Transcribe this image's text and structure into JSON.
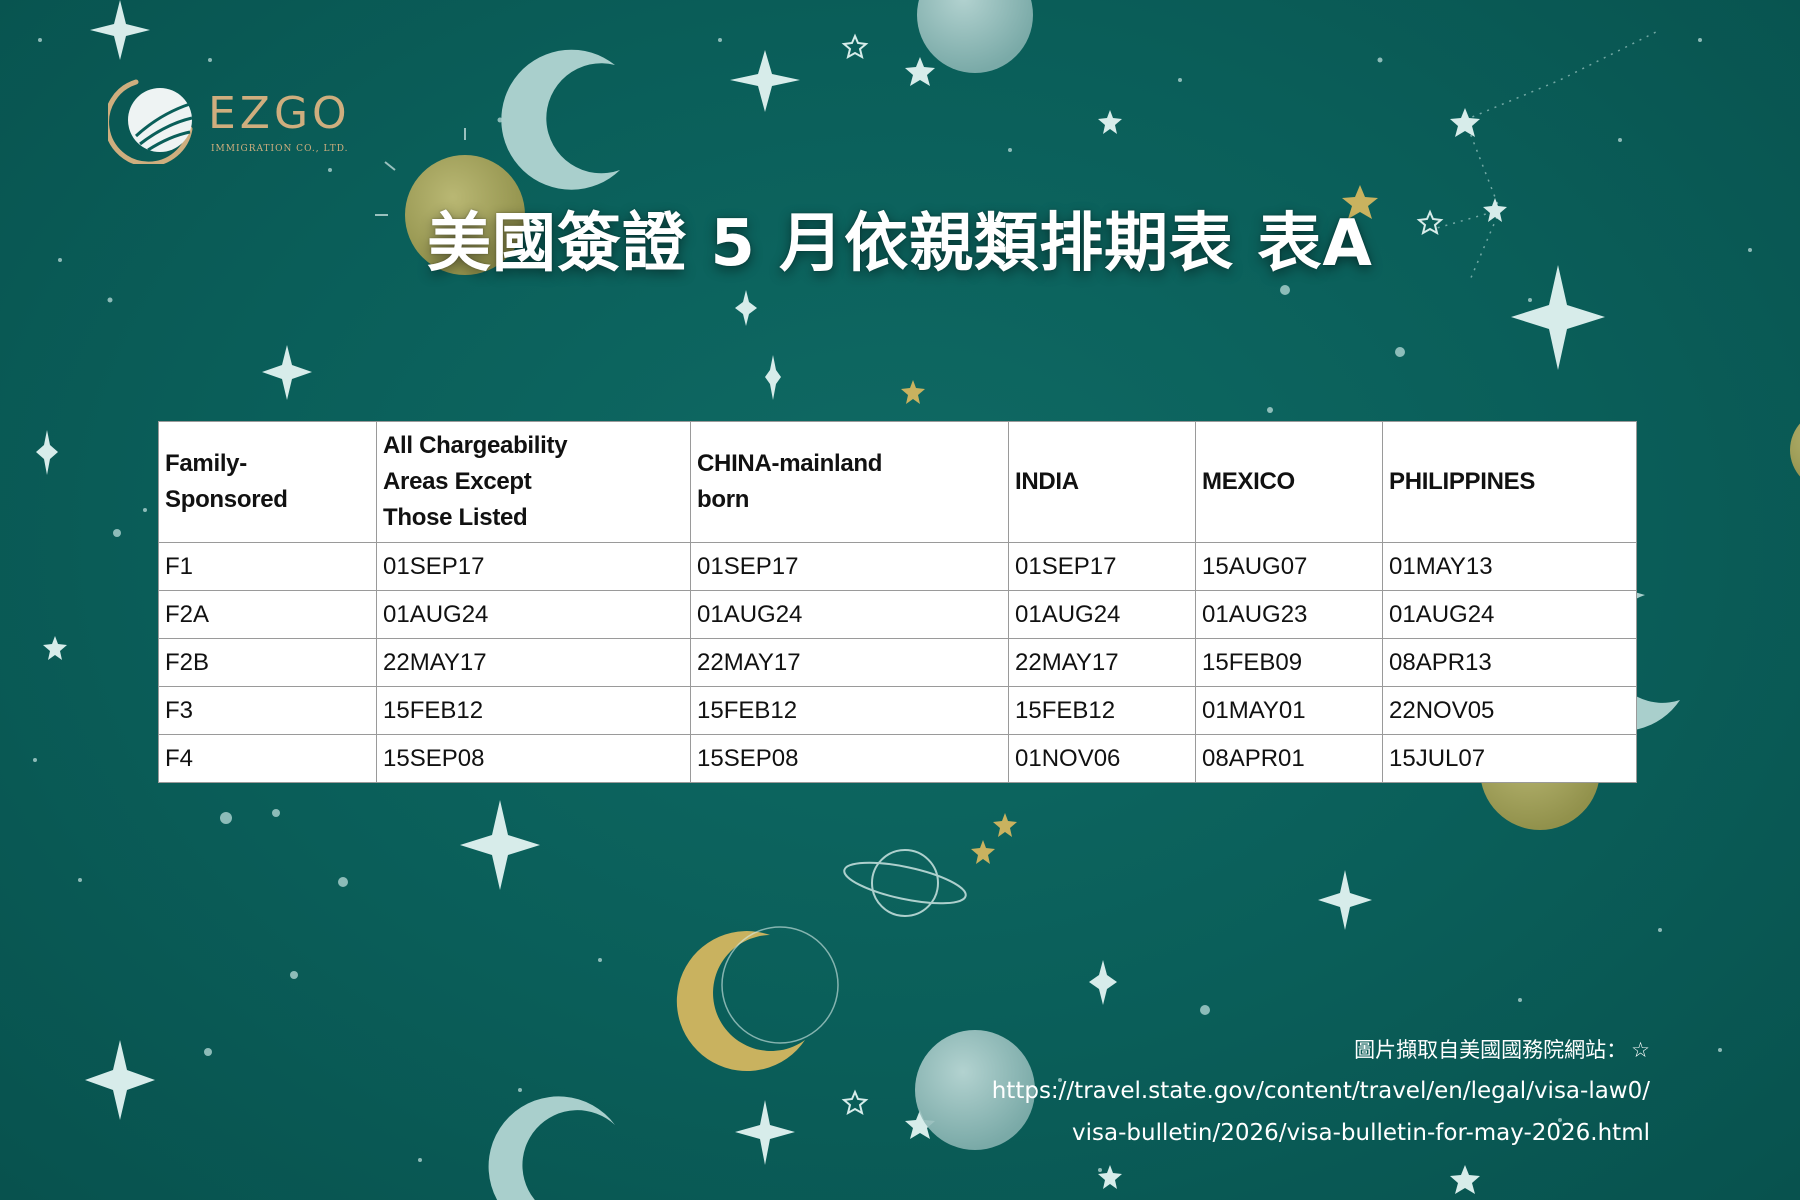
{
  "logo": {
    "name": "EZGO",
    "subtitle": "IMMIGRATION CO., LTD."
  },
  "title": "美國簽證 5 月依親類排期表 表A",
  "table": {
    "headers": [
      "Family-\nSponsored",
      "All Chargeability\nAreas Except\nThose Listed",
      "CHINA-mainland\nborn",
      "INDIA",
      "MEXICO",
      "PHILIPPINES"
    ],
    "rows": [
      [
        "F1",
        "01SEP17",
        "01SEP17",
        "01SEP17",
        "15AUG07",
        "01MAY13"
      ],
      [
        "F2A",
        "01AUG24",
        "01AUG24",
        "01AUG24",
        "01AUG23",
        "01AUG24"
      ],
      [
        "F2B",
        "22MAY17",
        "22MAY17",
        "22MAY17",
        "15FEB09",
        "08APR13"
      ],
      [
        "F3",
        "15FEB12",
        "15FEB12",
        "15FEB12",
        "01MAY01",
        "22NOV05"
      ],
      [
        "F4",
        "15SEP08",
        "15SEP08",
        "01NOV06",
        "08APR01",
        "15JUL07"
      ]
    ]
  },
  "source": {
    "label": "圖片擷取自美國國務院網站：",
    "url_line1": "https://travel.state.gov/content/travel/en/legal/visa-law0/",
    "url_line2": "visa-bulletin/2026/visa-bulletin-for-may-2026.html"
  },
  "colors": {
    "background": "#0a5e59",
    "accent_gold": "#cfae7e",
    "moon_pale": "#9ec4c2",
    "moon_gold": "#c9b25f",
    "star": "#dcefee"
  },
  "icons": [
    "logo-globe-icon",
    "star-icon",
    "crescent-moon-icon",
    "planet-icon",
    "sun-icon",
    "star-outline-icon"
  ]
}
